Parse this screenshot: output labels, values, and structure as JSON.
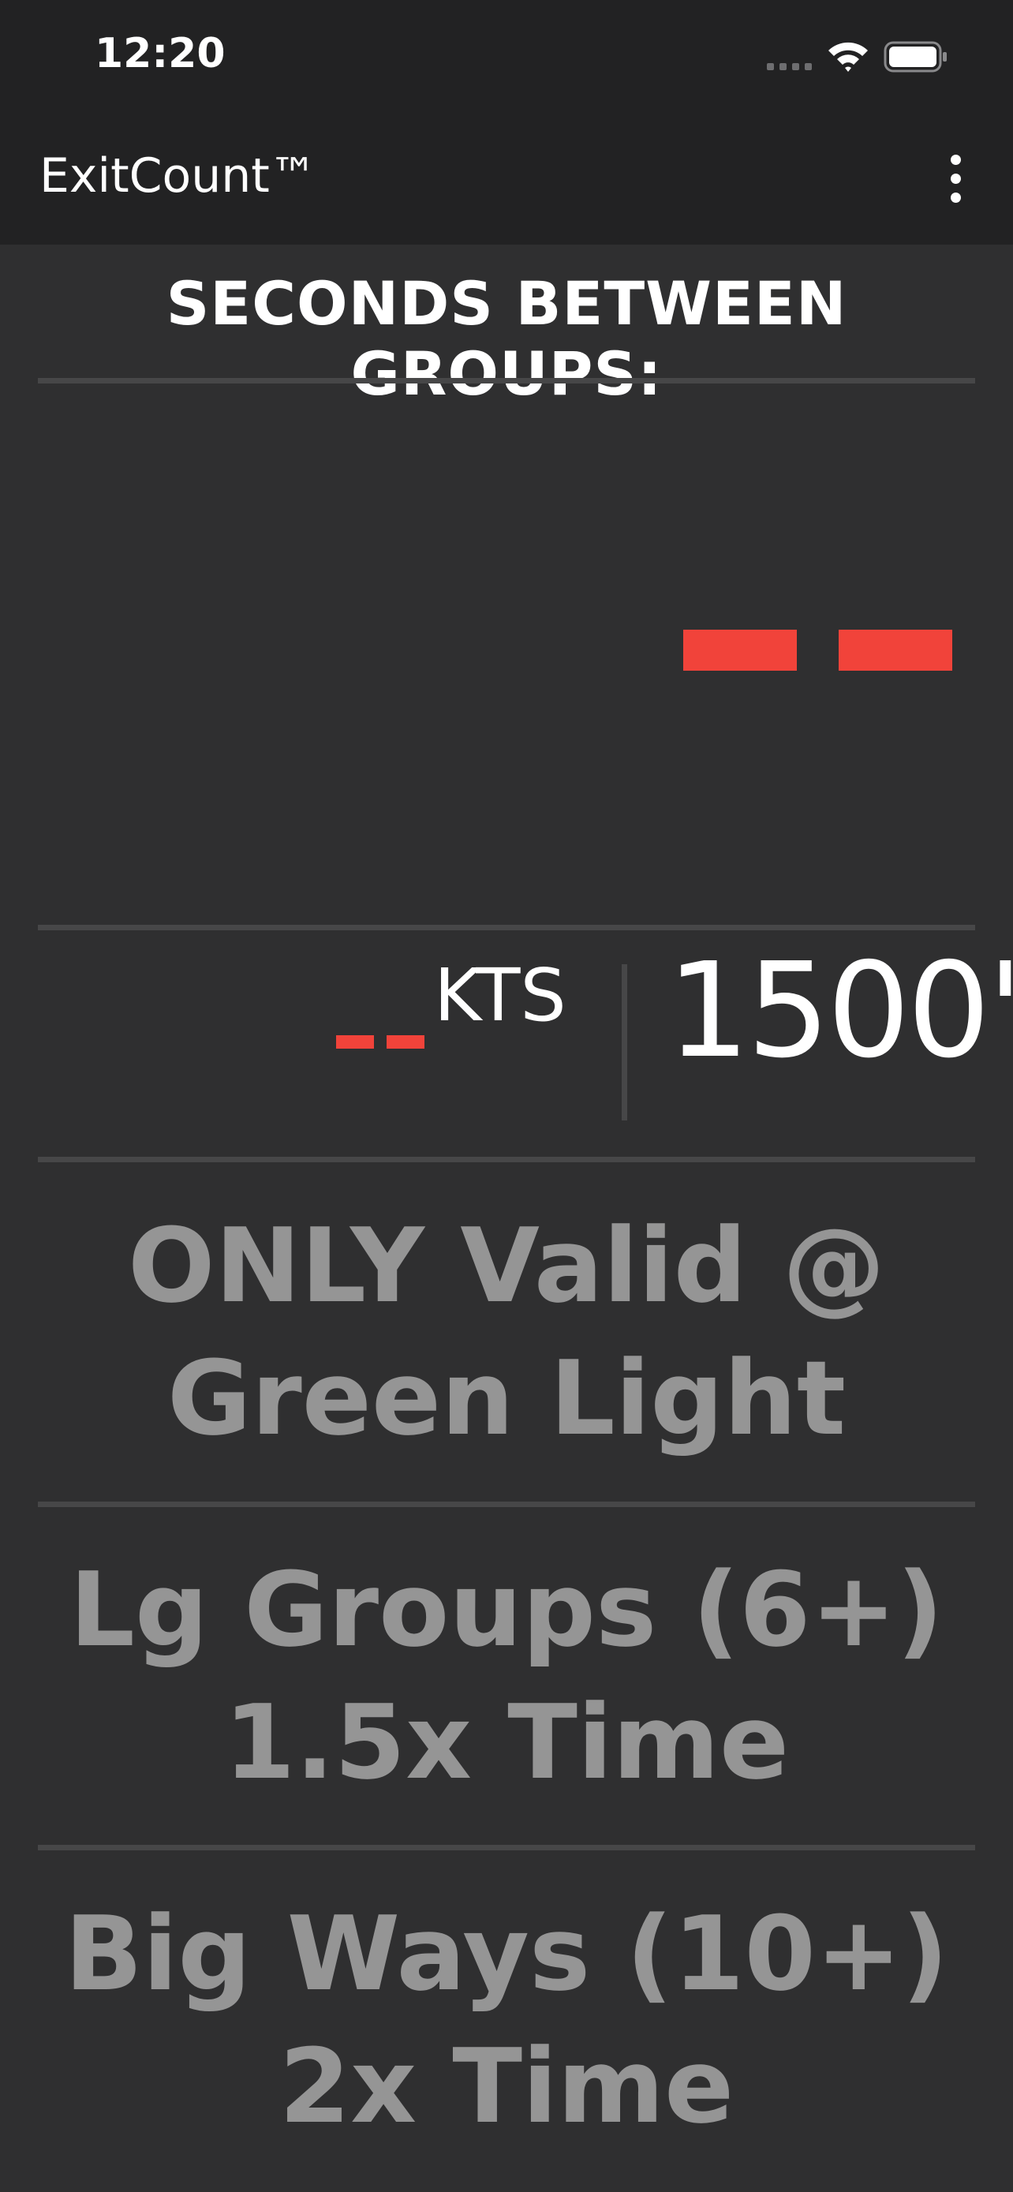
{
  "status_bar": {
    "time": "12:20"
  },
  "app_bar": {
    "title": "ExitCount™",
    "menu_icon": "more-vert-icon"
  },
  "heading": "SECONDS BETWEEN GROUPS:",
  "seconds_display": {
    "value": "--",
    "color": "#f1433a"
  },
  "speed": {
    "value": "--",
    "unit": "KTS"
  },
  "altitude": "1500'",
  "notes": [
    {
      "line1": "ONLY Valid @",
      "line2": "Green Light"
    },
    {
      "line1": "Lg Groups (6+)",
      "line2": "1.5x Time"
    },
    {
      "line1": "Big Ways (10+)",
      "line2": "2x Time"
    }
  ]
}
